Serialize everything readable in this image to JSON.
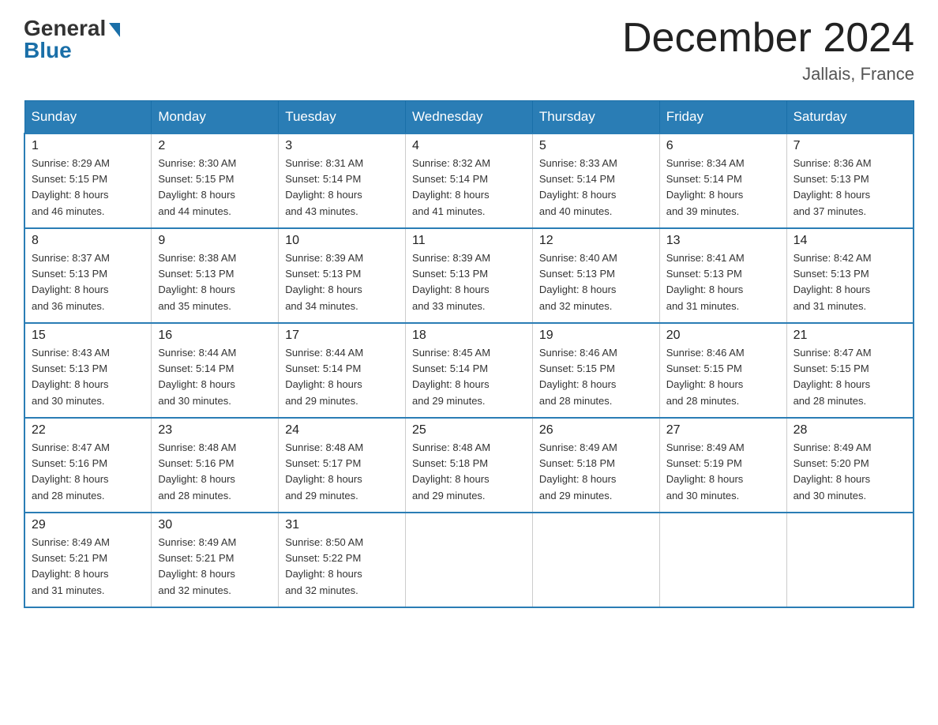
{
  "header": {
    "logo_general": "General",
    "logo_blue": "Blue",
    "month_title": "December 2024",
    "location": "Jallais, France"
  },
  "days_of_week": [
    "Sunday",
    "Monday",
    "Tuesday",
    "Wednesday",
    "Thursday",
    "Friday",
    "Saturday"
  ],
  "weeks": [
    [
      {
        "num": "1",
        "sunrise": "Sunrise: 8:29 AM",
        "sunset": "Sunset: 5:15 PM",
        "daylight": "Daylight: 8 hours",
        "daylight2": "and 46 minutes."
      },
      {
        "num": "2",
        "sunrise": "Sunrise: 8:30 AM",
        "sunset": "Sunset: 5:15 PM",
        "daylight": "Daylight: 8 hours",
        "daylight2": "and 44 minutes."
      },
      {
        "num": "3",
        "sunrise": "Sunrise: 8:31 AM",
        "sunset": "Sunset: 5:14 PM",
        "daylight": "Daylight: 8 hours",
        "daylight2": "and 43 minutes."
      },
      {
        "num": "4",
        "sunrise": "Sunrise: 8:32 AM",
        "sunset": "Sunset: 5:14 PM",
        "daylight": "Daylight: 8 hours",
        "daylight2": "and 41 minutes."
      },
      {
        "num": "5",
        "sunrise": "Sunrise: 8:33 AM",
        "sunset": "Sunset: 5:14 PM",
        "daylight": "Daylight: 8 hours",
        "daylight2": "and 40 minutes."
      },
      {
        "num": "6",
        "sunrise": "Sunrise: 8:34 AM",
        "sunset": "Sunset: 5:14 PM",
        "daylight": "Daylight: 8 hours",
        "daylight2": "and 39 minutes."
      },
      {
        "num": "7",
        "sunrise": "Sunrise: 8:36 AM",
        "sunset": "Sunset: 5:13 PM",
        "daylight": "Daylight: 8 hours",
        "daylight2": "and 37 minutes."
      }
    ],
    [
      {
        "num": "8",
        "sunrise": "Sunrise: 8:37 AM",
        "sunset": "Sunset: 5:13 PM",
        "daylight": "Daylight: 8 hours",
        "daylight2": "and 36 minutes."
      },
      {
        "num": "9",
        "sunrise": "Sunrise: 8:38 AM",
        "sunset": "Sunset: 5:13 PM",
        "daylight": "Daylight: 8 hours",
        "daylight2": "and 35 minutes."
      },
      {
        "num": "10",
        "sunrise": "Sunrise: 8:39 AM",
        "sunset": "Sunset: 5:13 PM",
        "daylight": "Daylight: 8 hours",
        "daylight2": "and 34 minutes."
      },
      {
        "num": "11",
        "sunrise": "Sunrise: 8:39 AM",
        "sunset": "Sunset: 5:13 PM",
        "daylight": "Daylight: 8 hours",
        "daylight2": "and 33 minutes."
      },
      {
        "num": "12",
        "sunrise": "Sunrise: 8:40 AM",
        "sunset": "Sunset: 5:13 PM",
        "daylight": "Daylight: 8 hours",
        "daylight2": "and 32 minutes."
      },
      {
        "num": "13",
        "sunrise": "Sunrise: 8:41 AM",
        "sunset": "Sunset: 5:13 PM",
        "daylight": "Daylight: 8 hours",
        "daylight2": "and 31 minutes."
      },
      {
        "num": "14",
        "sunrise": "Sunrise: 8:42 AM",
        "sunset": "Sunset: 5:13 PM",
        "daylight": "Daylight: 8 hours",
        "daylight2": "and 31 minutes."
      }
    ],
    [
      {
        "num": "15",
        "sunrise": "Sunrise: 8:43 AM",
        "sunset": "Sunset: 5:13 PM",
        "daylight": "Daylight: 8 hours",
        "daylight2": "and 30 minutes."
      },
      {
        "num": "16",
        "sunrise": "Sunrise: 8:44 AM",
        "sunset": "Sunset: 5:14 PM",
        "daylight": "Daylight: 8 hours",
        "daylight2": "and 30 minutes."
      },
      {
        "num": "17",
        "sunrise": "Sunrise: 8:44 AM",
        "sunset": "Sunset: 5:14 PM",
        "daylight": "Daylight: 8 hours",
        "daylight2": "and 29 minutes."
      },
      {
        "num": "18",
        "sunrise": "Sunrise: 8:45 AM",
        "sunset": "Sunset: 5:14 PM",
        "daylight": "Daylight: 8 hours",
        "daylight2": "and 29 minutes."
      },
      {
        "num": "19",
        "sunrise": "Sunrise: 8:46 AM",
        "sunset": "Sunset: 5:15 PM",
        "daylight": "Daylight: 8 hours",
        "daylight2": "and 28 minutes."
      },
      {
        "num": "20",
        "sunrise": "Sunrise: 8:46 AM",
        "sunset": "Sunset: 5:15 PM",
        "daylight": "Daylight: 8 hours",
        "daylight2": "and 28 minutes."
      },
      {
        "num": "21",
        "sunrise": "Sunrise: 8:47 AM",
        "sunset": "Sunset: 5:15 PM",
        "daylight": "Daylight: 8 hours",
        "daylight2": "and 28 minutes."
      }
    ],
    [
      {
        "num": "22",
        "sunrise": "Sunrise: 8:47 AM",
        "sunset": "Sunset: 5:16 PM",
        "daylight": "Daylight: 8 hours",
        "daylight2": "and 28 minutes."
      },
      {
        "num": "23",
        "sunrise": "Sunrise: 8:48 AM",
        "sunset": "Sunset: 5:16 PM",
        "daylight": "Daylight: 8 hours",
        "daylight2": "and 28 minutes."
      },
      {
        "num": "24",
        "sunrise": "Sunrise: 8:48 AM",
        "sunset": "Sunset: 5:17 PM",
        "daylight": "Daylight: 8 hours",
        "daylight2": "and 29 minutes."
      },
      {
        "num": "25",
        "sunrise": "Sunrise: 8:48 AM",
        "sunset": "Sunset: 5:18 PM",
        "daylight": "Daylight: 8 hours",
        "daylight2": "and 29 minutes."
      },
      {
        "num": "26",
        "sunrise": "Sunrise: 8:49 AM",
        "sunset": "Sunset: 5:18 PM",
        "daylight": "Daylight: 8 hours",
        "daylight2": "and 29 minutes."
      },
      {
        "num": "27",
        "sunrise": "Sunrise: 8:49 AM",
        "sunset": "Sunset: 5:19 PM",
        "daylight": "Daylight: 8 hours",
        "daylight2": "and 30 minutes."
      },
      {
        "num": "28",
        "sunrise": "Sunrise: 8:49 AM",
        "sunset": "Sunset: 5:20 PM",
        "daylight": "Daylight: 8 hours",
        "daylight2": "and 30 minutes."
      }
    ],
    [
      {
        "num": "29",
        "sunrise": "Sunrise: 8:49 AM",
        "sunset": "Sunset: 5:21 PM",
        "daylight": "Daylight: 8 hours",
        "daylight2": "and 31 minutes."
      },
      {
        "num": "30",
        "sunrise": "Sunrise: 8:49 AM",
        "sunset": "Sunset: 5:21 PM",
        "daylight": "Daylight: 8 hours",
        "daylight2": "and 32 minutes."
      },
      {
        "num": "31",
        "sunrise": "Sunrise: 8:50 AM",
        "sunset": "Sunset: 5:22 PM",
        "daylight": "Daylight: 8 hours",
        "daylight2": "and 32 minutes."
      },
      null,
      null,
      null,
      null
    ]
  ]
}
